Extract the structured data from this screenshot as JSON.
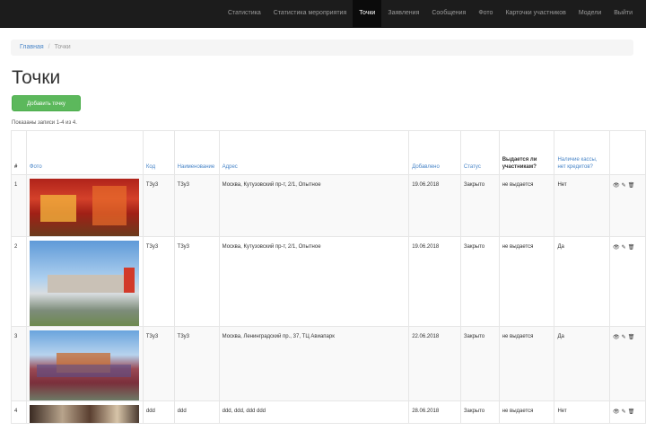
{
  "navbar": {
    "items": [
      {
        "label": "Статистика",
        "active": false
      },
      {
        "label": "Статистика мероприятия",
        "active": false
      },
      {
        "label": "Точки",
        "active": true
      },
      {
        "label": "Заявления",
        "active": false
      },
      {
        "label": "Сообщения",
        "active": false
      },
      {
        "label": "Фото",
        "active": false
      },
      {
        "label": "Карточки участников",
        "active": false
      },
      {
        "label": "Модели",
        "active": false
      },
      {
        "label": "Выйти",
        "active": false
      }
    ]
  },
  "breadcrumb": {
    "home": "Главная",
    "separator": "/",
    "current": "Точки"
  },
  "page": {
    "title": "Точки",
    "add_button": "Добавить точку",
    "summary": "Показаны записи 1-4 из 4."
  },
  "table": {
    "headers": [
      "#",
      "Фото",
      "Код",
      "Наименование",
      "Адрес",
      "Добавлено",
      "Статус",
      "Выдается ли участникам?",
      "Наличие кассы, нет кредитов?",
      ""
    ],
    "rows": [
      {
        "num": "1",
        "photo": "photo-1",
        "code": "Т3у3",
        "name": "Т3у3",
        "address": "Москва, Кутузовский пр-т, 2/1, Опытное",
        "added": "19.06.2018",
        "status": "Закрыто",
        "issued": "не выдается",
        "cashier": "Нет",
        "actions": [
          "👁",
          "✎",
          "🗑"
        ]
      },
      {
        "num": "2",
        "photo": "photo-2",
        "code": "Т3у3",
        "name": "Т3у3",
        "address": "Москва, Кутузовский пр-т, 2/1, Опытное",
        "added": "19.06.2018",
        "status": "Закрыто",
        "issued": "не выдается",
        "cashier": "Да",
        "actions": [
          "👁",
          "✎",
          "🗑"
        ]
      },
      {
        "num": "3",
        "photo": "photo-3",
        "code": "Т3у3",
        "name": "Т3у3",
        "address": "Москва, Ленинградский пр., 37, ТЦ Авиапарк",
        "added": "22.06.2018",
        "status": "Закрыто",
        "issued": "не выдается",
        "cashier": "Да",
        "actions": [
          "👁",
          "✎",
          "🗑"
        ]
      },
      {
        "num": "4",
        "photo": "photo-4",
        "code": "ddd",
        "name": "ddd",
        "address": "ddd, ddd, ddd ddd",
        "added": "28.06.2018",
        "status": "Закрыто",
        "issued": "не выдается",
        "cashier": "Нет",
        "actions": [
          "👁",
          "✎",
          "🗑"
        ]
      }
    ]
  }
}
